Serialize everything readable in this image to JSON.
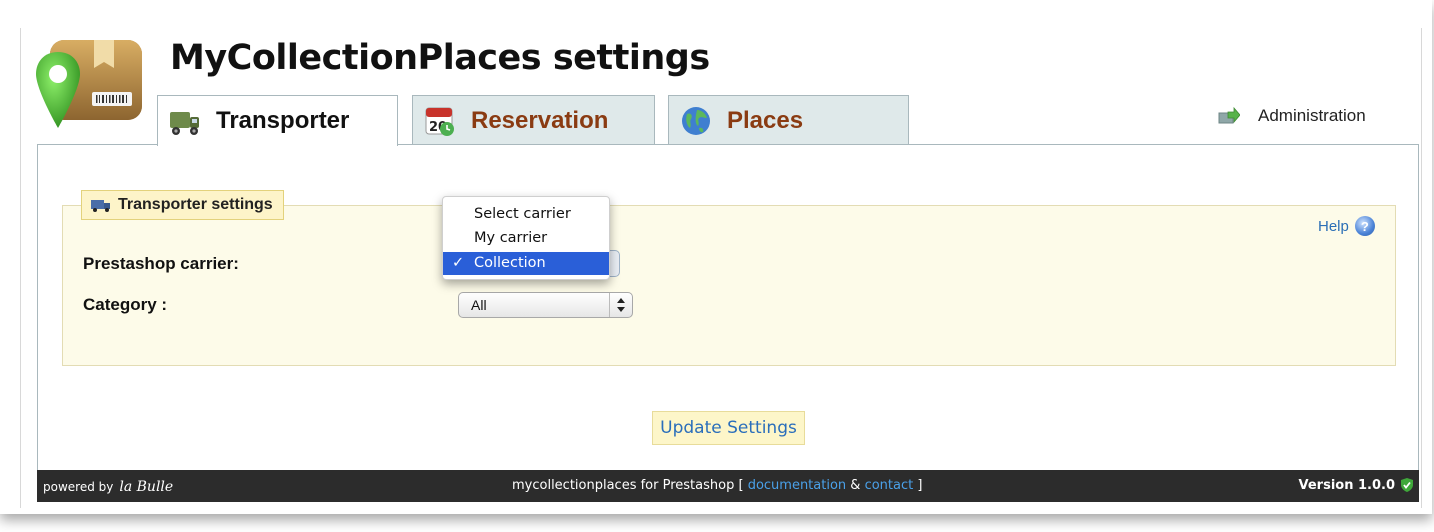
{
  "app": {
    "title": "MyCollectionPlaces settings"
  },
  "tabs": [
    {
      "label": "Transporter",
      "icon": "truck-icon",
      "active": true
    },
    {
      "label": "Reservation",
      "icon": "calendar-icon",
      "active": false
    },
    {
      "label": "Places",
      "icon": "globe-icon",
      "active": false
    }
  ],
  "admin": {
    "label": "Administration",
    "icon": "arrow-right-icon"
  },
  "settings": {
    "legend": "Transporter settings",
    "help_label": "Help",
    "carrier_label": "Prestashop carrier:",
    "category_label": "Category :",
    "carrier_options": [
      "Select carrier",
      "My carrier",
      "Collection"
    ],
    "carrier_selected": "Collection",
    "category_value": "All"
  },
  "actions": {
    "update_label": "Update Settings"
  },
  "footer": {
    "powered_by": "powered by",
    "brand": "la Bulle",
    "center_prefix": "mycollectionplaces for Prestashop [",
    "doc_link": "documentation",
    "amp": "&",
    "contact_link": "contact",
    "center_suffix": "]",
    "version": "Version 1.0.0"
  },
  "colors": {
    "accent_tab_text": "#8a3b12",
    "link": "#2b6fb6",
    "footer_bg": "#2c2c2c",
    "selected_option": "#2a5fd8"
  }
}
